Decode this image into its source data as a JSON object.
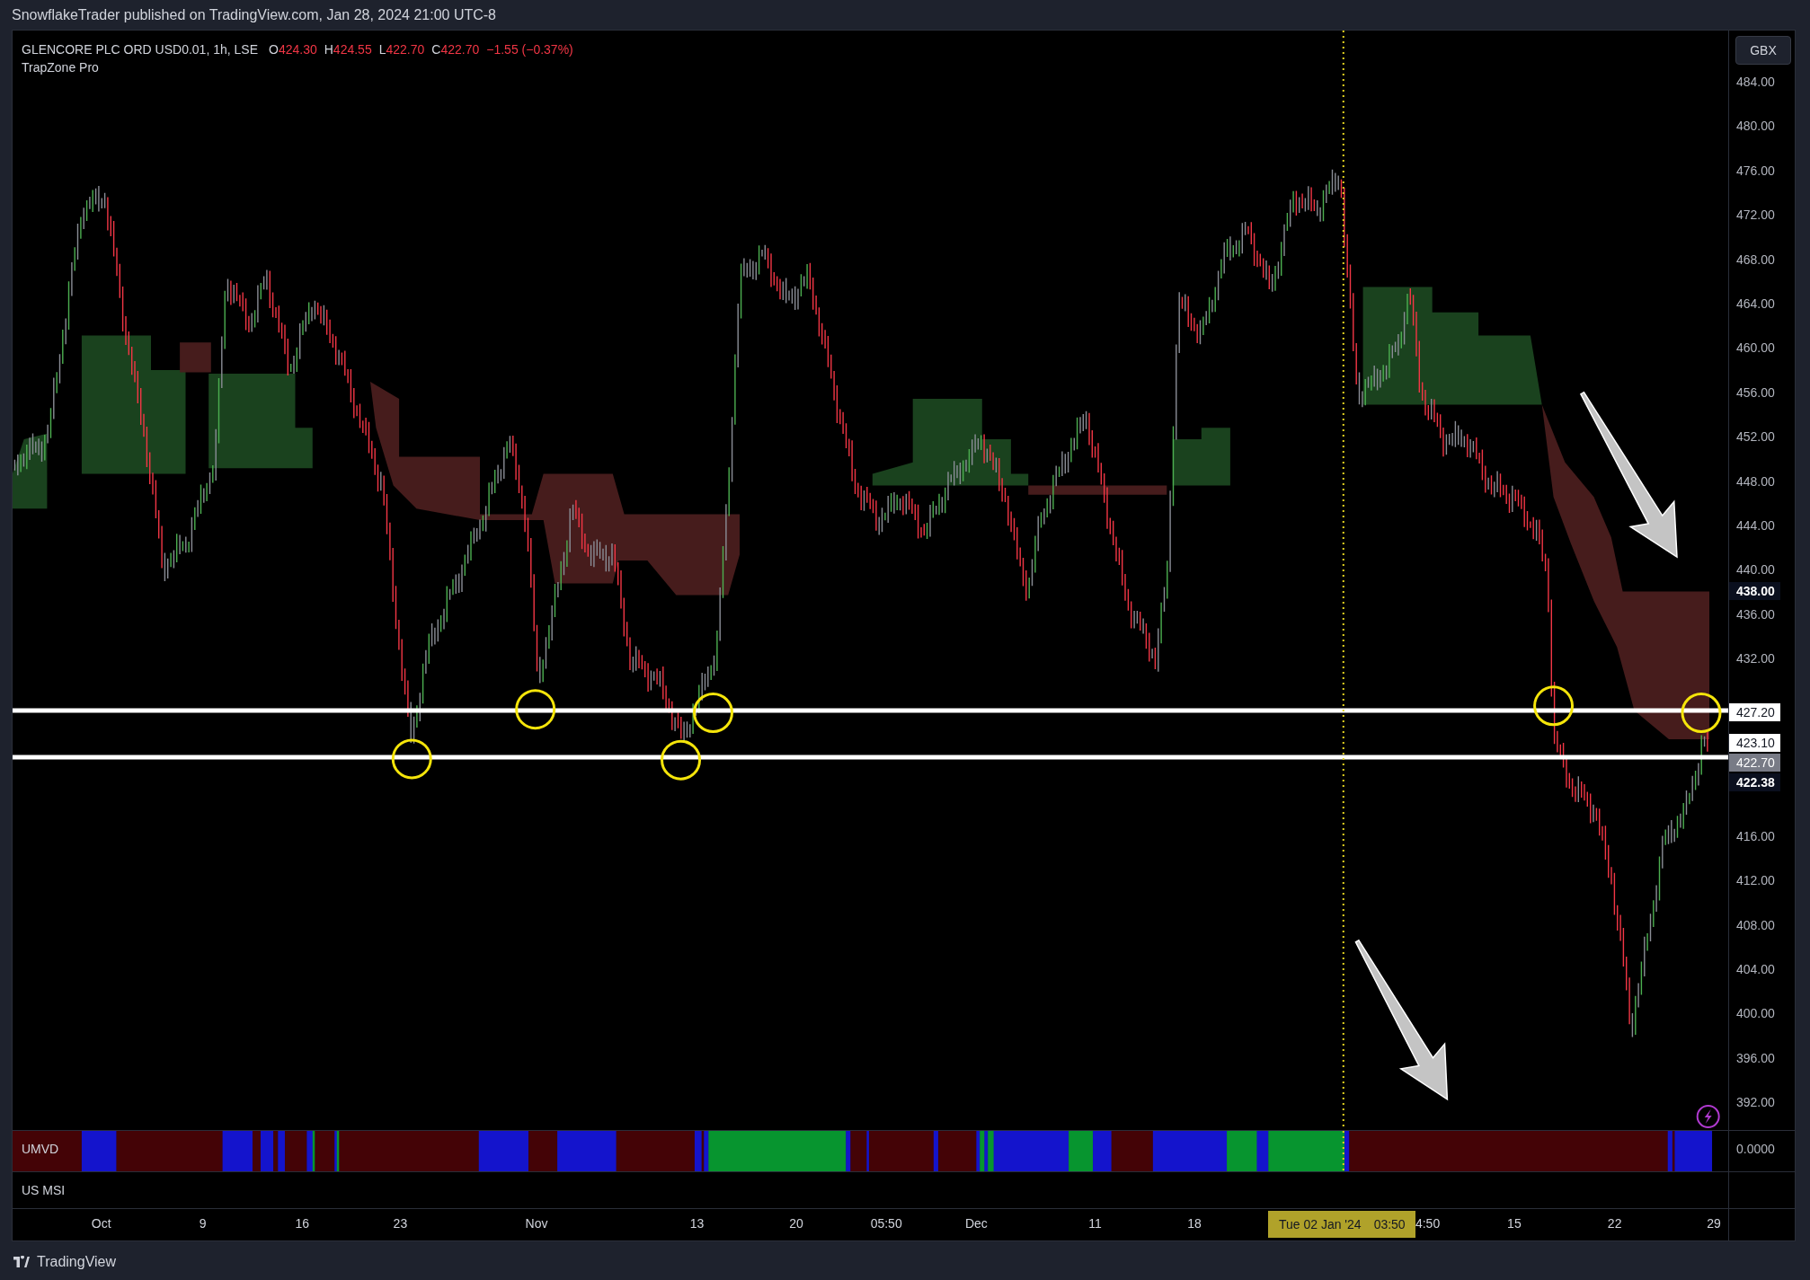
{
  "attribution": "SnowflakeTrader published on TradingView.com, Jan 28, 2024 21:00 UTC-8",
  "legend": {
    "symbol": "GLENCORE PLC ORD USD0.01, 1h, LSE",
    "ohlc": [
      {
        "key": "O",
        "value": "424.30"
      },
      {
        "key": "H",
        "value": "424.55"
      },
      {
        "key": "L",
        "value": "422.70"
      },
      {
        "key": "C",
        "value": "422.70"
      }
    ],
    "change": "−1.55 (−0.37%)",
    "indicator": "TrapZone Pro"
  },
  "currency_button": "GBX",
  "price_axis": {
    "ticks": [
      "484.00",
      "480.00",
      "476.00",
      "472.00",
      "468.00",
      "464.00",
      "460.00",
      "456.00",
      "452.00",
      "448.00",
      "444.00",
      "440.00",
      "436.00",
      "432.00",
      "416.00",
      "412.00",
      "408.00",
      "404.00",
      "400.00",
      "396.00",
      "392.00"
    ],
    "labels": [
      {
        "text": "438.00",
        "kind": "dark"
      },
      {
        "text": "427.20",
        "kind": "light"
      },
      {
        "text": "423.10",
        "kind": "light"
      },
      {
        "text": "422.70",
        "kind": "grey"
      },
      {
        "text": "422.38",
        "kind": "dark"
      }
    ]
  },
  "panes": [
    {
      "name": "UMVD",
      "value": "0.0000"
    },
    {
      "name": "US MSI"
    }
  ],
  "time_axis": {
    "ticks": [
      "Oct",
      "9",
      "16",
      "23",
      "Nov",
      "13",
      "20",
      "05:50",
      "Dec",
      "11",
      "18",
      "4:50",
      "15",
      "22",
      "29"
    ],
    "crosshair_label": [
      "Tue 02 Jan '24",
      "03:50"
    ]
  },
  "footer": {
    "brand": "TradingView"
  }
}
